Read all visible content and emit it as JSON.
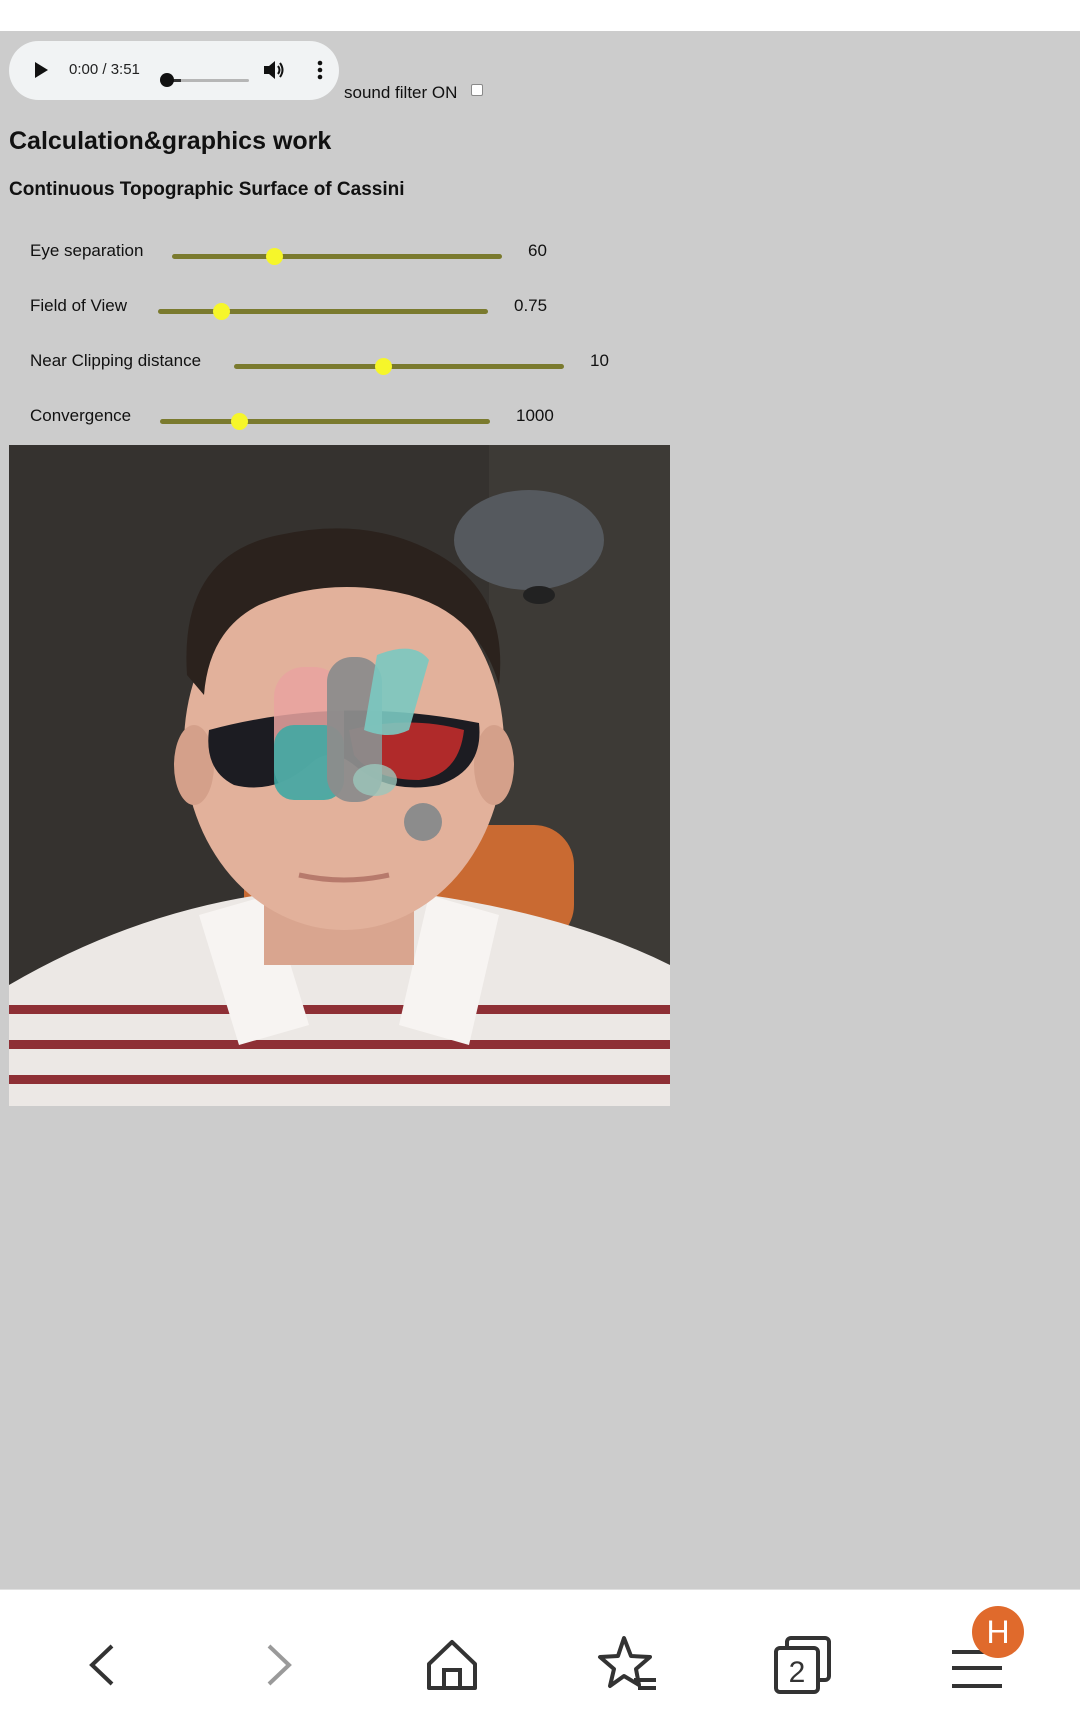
{
  "audio": {
    "time": "0:00 / 3:51",
    "progress": 0.0
  },
  "filter": {
    "label": "sound filter ON",
    "checked": false
  },
  "headings": {
    "title": "Calculation&graphics work",
    "subtitle": "Continuous Topographic Surface of Cassini"
  },
  "controls": [
    {
      "label": "Eye separation",
      "value": "60",
      "fraction": 0.31
    },
    {
      "label": "Field of View",
      "value": "0.75",
      "fraction": 0.19
    },
    {
      "label": "Near Clipping distance",
      "value": "10",
      "fraction": 0.45
    },
    {
      "label": "Convergence",
      "value": "1000",
      "fraction": 0.24
    }
  ],
  "colors": {
    "slider_track": "#7a7a2e",
    "slider_knob": "#f6f62a",
    "avatar": "#e06a2c",
    "page_bg": "#cccccc"
  },
  "nav": {
    "avatar_letter": "H",
    "tab_count": "2"
  },
  "icons": [
    "play-icon",
    "volume-icon",
    "more-vert-icon",
    "back-icon",
    "forward-icon",
    "home-icon",
    "bookmarks-icon",
    "tabs-icon",
    "menu-icon"
  ]
}
